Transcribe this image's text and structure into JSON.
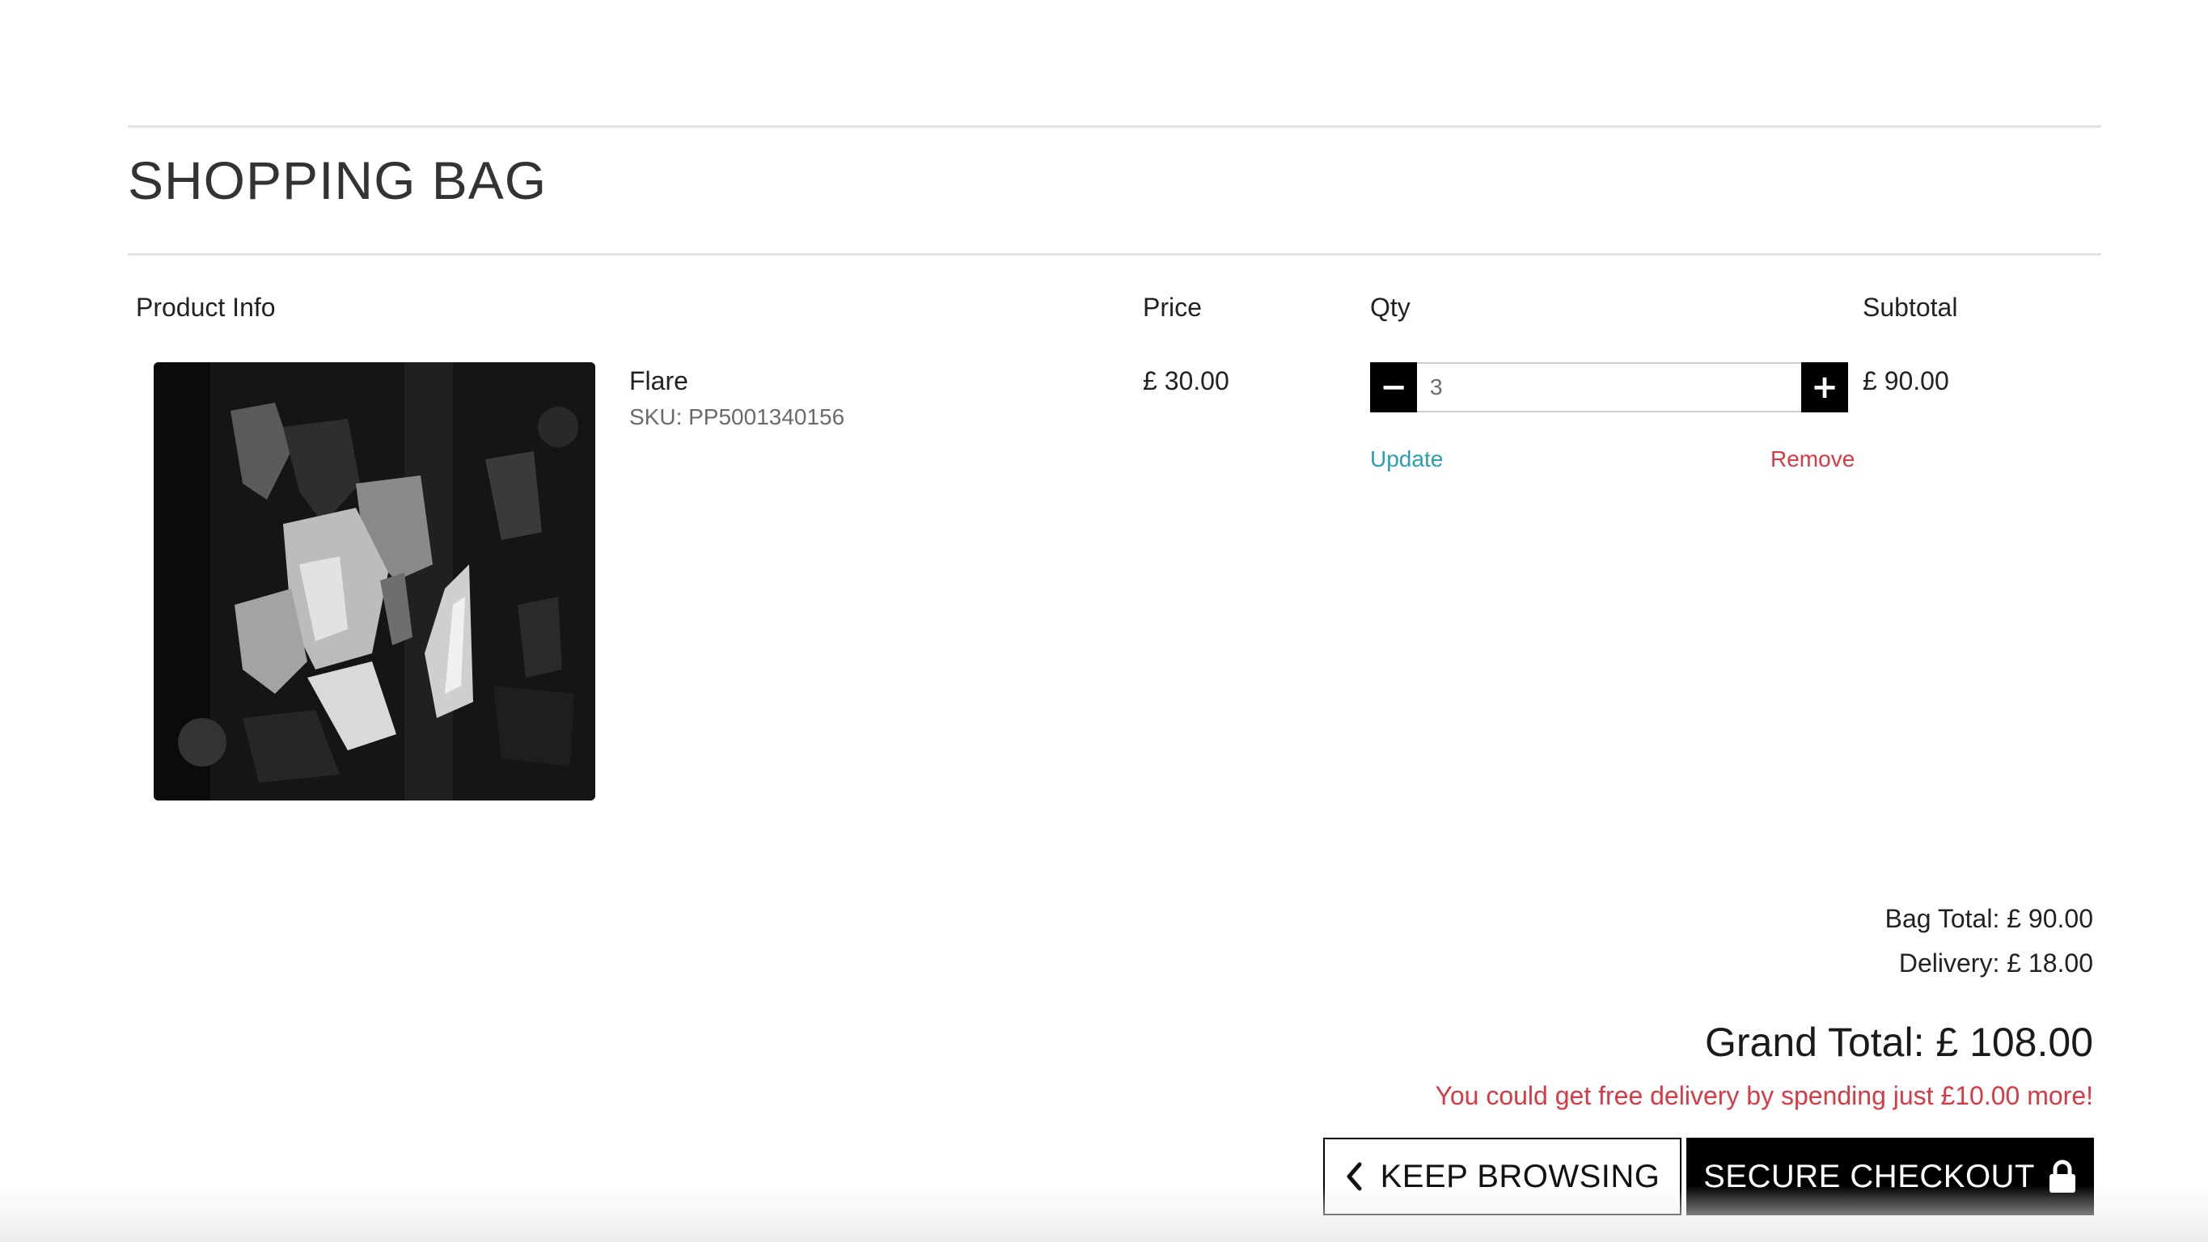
{
  "page": {
    "title": "SHOPPING BAG"
  },
  "table": {
    "headers": {
      "product_info": "Product Info",
      "price": "Price",
      "qty": "Qty",
      "subtotal": "Subtotal"
    }
  },
  "items": [
    {
      "name": "Flare",
      "sku": "SKU: PP5001340156",
      "price": "£ 30.00",
      "quantity": "3",
      "subtotal": "£ 90.00",
      "update_label": "Update",
      "remove_label": "Remove",
      "minus_symbol": "−",
      "plus_symbol": "+"
    }
  ],
  "summary": {
    "bag_total": "Bag Total: £ 90.00",
    "delivery": "Delivery: £ 18.00",
    "grand_total": "Grand Total: £ 108.00",
    "free_delivery_message": "You could get free delivery by spending just £10.00 more!"
  },
  "actions": {
    "keep_browsing": "KEEP BROWSING",
    "secure_checkout": "SECURE CHECKOUT"
  },
  "icons": {
    "keep_browsing": "chevron-left-icon",
    "secure_checkout": "lock-icon"
  },
  "colors": {
    "link": "#2b9fb0",
    "danger": "#d83a45",
    "primary_button": "#000000"
  }
}
